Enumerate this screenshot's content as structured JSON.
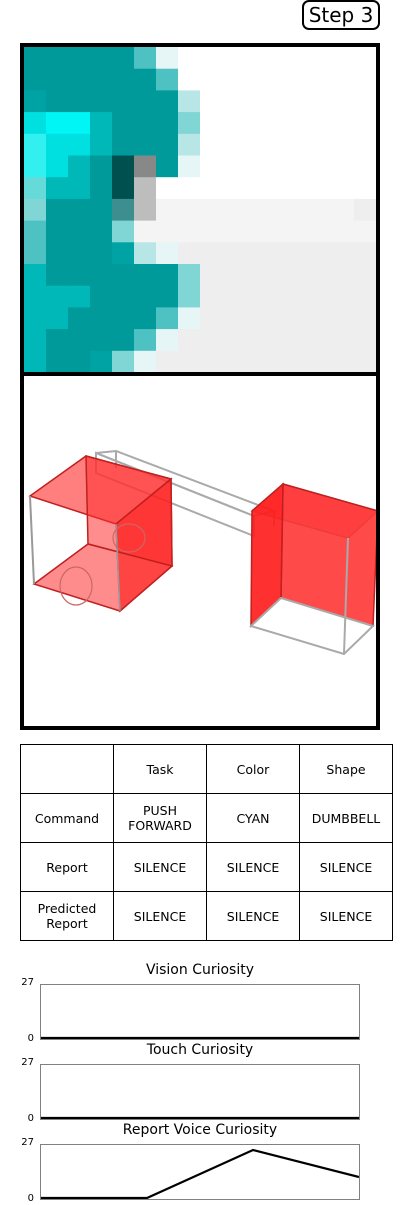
{
  "step_label": "Step 3",
  "table": {
    "header": [
      "",
      "Task",
      "Color",
      "Shape"
    ],
    "rows": [
      {
        "label": "Command",
        "task": "PUSH\nFORWARD",
        "color": "CYAN",
        "shape": "DUMBBELL"
      },
      {
        "label": "Report",
        "task": "SILENCE",
        "color": "SILENCE",
        "shape": "SILENCE"
      },
      {
        "label": "Predicted\nReport",
        "task": "SILENCE",
        "color": "SILENCE",
        "shape": "SILENCE"
      }
    ]
  },
  "chart_data": [
    {
      "type": "line",
      "title": "Vision Curiosity",
      "ylim": [
        0,
        27
      ],
      "yticks": [
        "27",
        "0"
      ],
      "x": [
        0,
        1,
        2,
        3
      ],
      "values": [
        0,
        0,
        0,
        0
      ]
    },
    {
      "type": "line",
      "title": "Touch Curiosity",
      "ylim": [
        0,
        27
      ],
      "yticks": [
        "27",
        "0"
      ],
      "x": [
        0,
        1,
        2,
        3
      ],
      "values": [
        0,
        0,
        0,
        0
      ]
    },
    {
      "type": "line",
      "title": "Report Voice Curiosity",
      "ylim": [
        0,
        27
      ],
      "yticks": [
        "27",
        "0"
      ],
      "x": [
        0,
        1,
        2,
        3
      ],
      "values": [
        0,
        0.5,
        24.5,
        11
      ]
    }
  ],
  "colors": {
    "cyan_dark": "#009999",
    "cyan_bright": "#00e5e5",
    "cube_red": "#ff2a2a",
    "frame_gray": "#9a9a9a"
  },
  "scene": {
    "left_object": "red open cube",
    "right_object": "red open cube",
    "connector": "wireframe bar"
  }
}
